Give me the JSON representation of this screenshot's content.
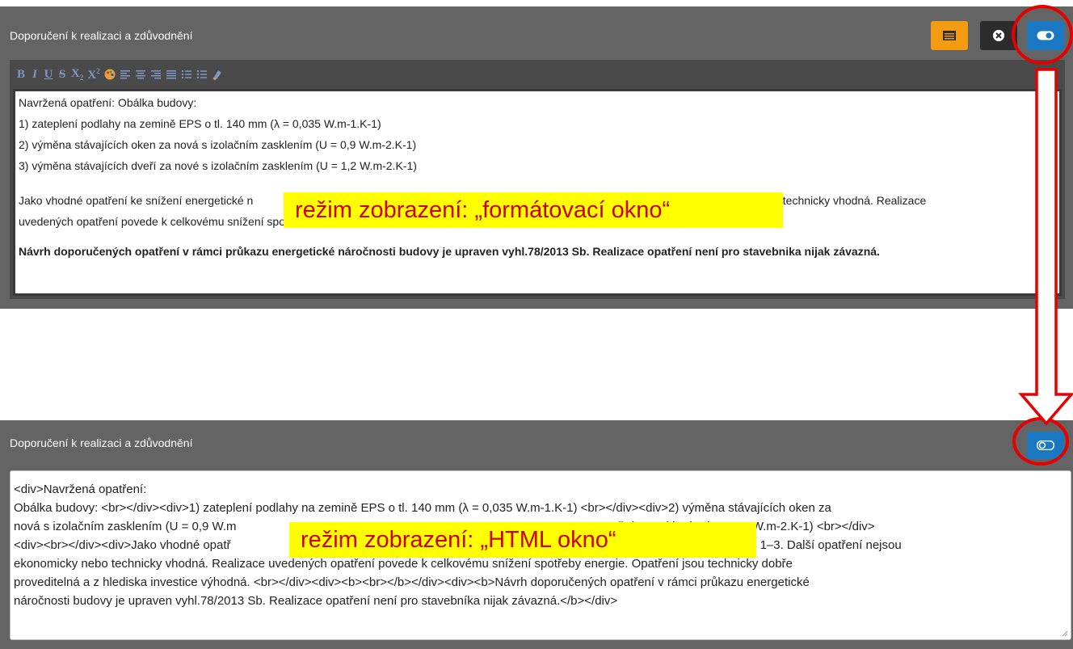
{
  "top_panel": {
    "title": "Doporučení k realizaci a zdůvodnění",
    "buttons": [
      {
        "name": "table-view-icon",
        "color": "#f39c12"
      },
      {
        "name": "close-icon",
        "color": "#2c2c2c"
      },
      {
        "name": "toggle-on-icon",
        "color": "#1a78c2"
      }
    ],
    "toolbar": [
      "B",
      "I",
      "U",
      "S",
      "X₂",
      "X²",
      "palette",
      "align-left",
      "align-center",
      "align-right",
      "align-justify",
      "ordered-list",
      "unordered-list",
      "clear-format"
    ],
    "content_lines": [
      "Navržená opatření: Obálka budovy:",
      "1) zateplení podlahy na zemině EPS o tl. 140 mm (λ = 0,035 W.m-1.K-1)",
      "2) výměna stávajících oken za nová s izolačním zasklením (U = 0,9 W.m-2.K-1)",
      "3) výměna stávajících dveří za nové s izolačním zasklením (U = 1,2 W.m-2.K-1)"
    ],
    "paragraph_line1_start": "Jako vhodné opatření ke snížení energetické n",
    "paragraph_line1_end": "omicky nebo technicky vhodná. Realizace",
    "paragraph_line2": "uvedených opatření povede k celkovému snížení spotřeby energie. Opatření jsou technicky dobře proveditelná a z hlediska investice výhodná.",
    "bold_line": "Návrh doporučených opatření v rámci průkazu energetické náročnosti budovy je upraven vyhl.78/2013 Sb. Realizace opatření není pro stavebnika nijak závazná."
  },
  "bottom_panel": {
    "title": "Doporučení k realizaci a zdůvodnění",
    "toggle_icon": "toggle-off-icon",
    "html_lines": [
      "<div>Navržená opatření:",
      "Obálka budovy: <br></div><div>1) zateplení podlahy na zemině EPS o tl. 140 mm (λ = 0,035 W.m-1.K-1) <br></div><div>2) výměna stávajících oken za",
      "nová s izolačním zasklením (U = 0,9 W.m",
      "<div><br></div><div>Jako vhodné opatř",
      "ekonomicky nebo technicky vhodná. Realizace uvedených opatření povede k celkovému snížení spotřeby energie. Opatření jsou technicky dobře",
      "proveditelná a z hlediska investice výhodná. <br></div><div><b><br></b></div><div><b>Návrh doporučených opatření v rámci průkazu energetické",
      "náročnosti budovy je upraven vyhl.78/2013 Sb. Realizace opatření není pro stavebníka nijak závazná.</b></div>"
    ],
    "html_line3_end": "čním zasklením (U = 1,2 W.m-2.K-1) <br></div>",
    "html_line4_end": "opatření č. 1–3. Další opatření nejsou"
  },
  "callouts": {
    "top": "režim zobrazení: „formátovací okno“",
    "bottom": "režim zobrazení: „HTML okno“"
  },
  "colors": {
    "panel": "#646464",
    "callout_bg": "#ffff00",
    "callout_text": "#cc0000",
    "annotation_red": "#e60000"
  }
}
